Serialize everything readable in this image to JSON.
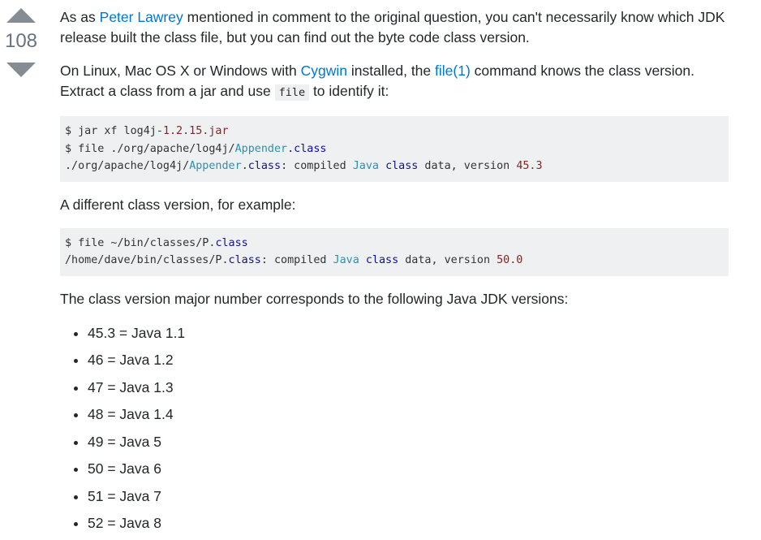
{
  "vote": {
    "count": "108"
  },
  "para1": {
    "prefix": "As as ",
    "link": "Peter Lawrey",
    "suffix": " mentioned in comment to the original question, you can't necessarily know which JDK release built the class file, but you can find out the byte code class version."
  },
  "para2": {
    "t1": "On Linux, Mac OS X or Windows with ",
    "link1": "Cygwin",
    "t2": " installed, the ",
    "link2": "file(1)",
    "t3": " command knows the class version. Extract a class from a jar and use ",
    "code": "file",
    "t4": " to identify it:"
  },
  "code1": {
    "line1": {
      "cmd": "$ jar xf log4j-",
      "arg": "1.2.15.jar"
    },
    "line2": {
      "cmd": "$ file ./org/apache/log4j/",
      "typ": "Appender",
      "ext": ".class"
    },
    "line3": {
      "path": "./org/apache/log4j/",
      "typ": "Appender",
      "mid": ".",
      "kw1": "class",
      "rest": ": compiled ",
      "typ2": "Java",
      "sp": " ",
      "kw2": "class",
      "rest2": " data, version ",
      "num": "45.3"
    }
  },
  "para3": "A different class version, for example:",
  "code2": {
    "line1": {
      "cmd": "$ file ~/bin/classes/P.",
      "kw": "class"
    },
    "line2": {
      "path": "/home/dave/bin/classes/P.",
      "kw1": "class",
      "rest": ": compiled ",
      "typ": "Java",
      "sp": " ",
      "kw2": "class",
      "rest2": " data, version ",
      "num": "50.0"
    }
  },
  "para4": "The class version major number corresponds to the following Java JDK versions:",
  "versions": [
    "45.3 = Java 1.1",
    "46 = Java 1.2",
    "47 = Java 1.3",
    "48 = Java 1.4",
    "49 = Java 5",
    "50 = Java 6",
    "51 = Java 7",
    "52 = Java 8"
  ]
}
